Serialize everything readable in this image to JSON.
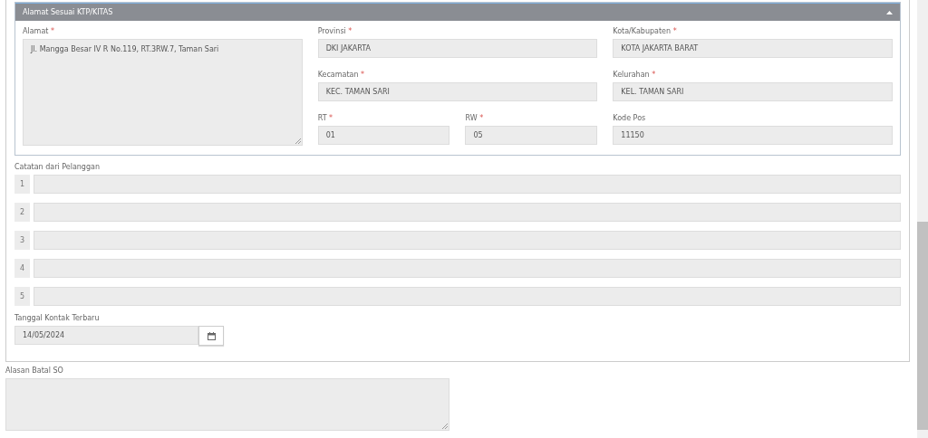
{
  "address_panel": {
    "title": "Alamat Sesuai KTP/KITAS",
    "expanded": true,
    "alamat": {
      "label": "Alamat",
      "mark": "*",
      "value": "Jl. Mangga Besar IV R No.119, RT.3RW.7, Taman Sari"
    },
    "provinsi": {
      "label": "Provinsi",
      "mark": "*",
      "value": "DKI JAKARTA"
    },
    "kota": {
      "label": "Kota/Kabupaten",
      "mark": "*",
      "value": "KOTA JAKARTA BARAT"
    },
    "kecamatan": {
      "label": "Kecamatan",
      "mark": "*",
      "value": "KEC. TAMAN SARI"
    },
    "kelurahan": {
      "label": "Kelurahan",
      "mark": "*",
      "value": "KEL. TAMAN SARI"
    },
    "rt": {
      "label": "RT",
      "mark": "*",
      "value": "01"
    },
    "rw": {
      "label": "RW",
      "mark": "*",
      "value": "05"
    },
    "kode_pos": {
      "label": "Kode Pos",
      "value": "11150"
    }
  },
  "notes": {
    "label": "Catatan dari Pelanggan",
    "rows": [
      {
        "number": "1"
      },
      {
        "number": "2"
      },
      {
        "number": "3"
      },
      {
        "number": "4"
      },
      {
        "number": "5"
      }
    ]
  },
  "last_contact": {
    "label": "Tanggal Kontak Terbaru",
    "value": "14/05/2024"
  },
  "cancel_reason": {
    "label": "Alasan Batal SO"
  }
}
